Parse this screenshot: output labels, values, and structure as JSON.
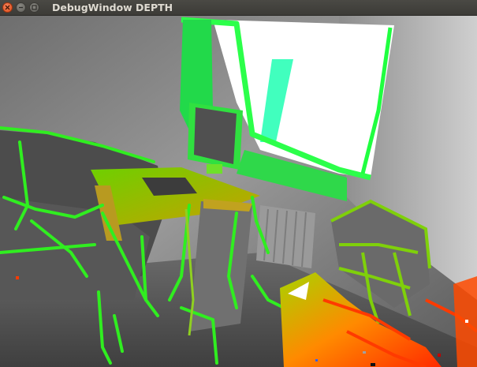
{
  "window": {
    "title": "DebugWindow DEPTH",
    "controls": {
      "close": "close-icon",
      "minimize": "minimize-icon",
      "maximize": "maximize-icon"
    }
  },
  "view": {
    "type": "depth-visualization",
    "colors": {
      "near": "#ff2a00",
      "mid": "#ffd000",
      "far": "#00ff3a",
      "window_glare": "#ffffff",
      "background_gray": "#7a7a7a"
    }
  }
}
